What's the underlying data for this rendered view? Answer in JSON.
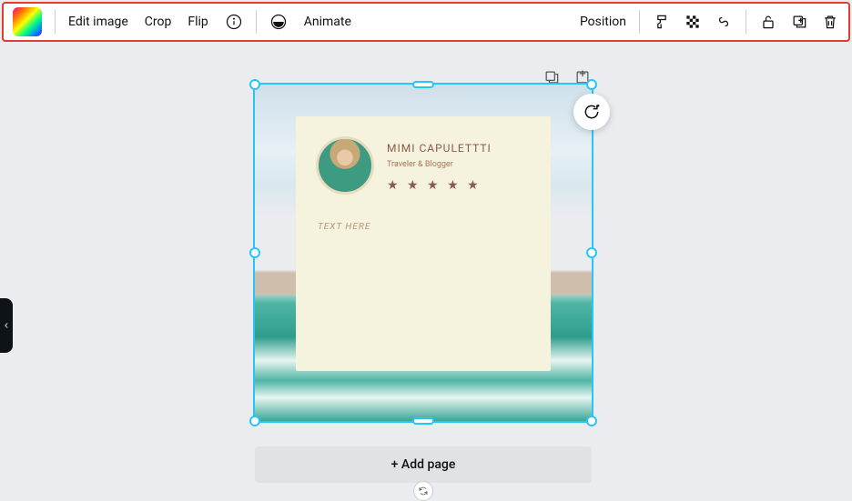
{
  "toolbar": {
    "edit_image": "Edit image",
    "crop": "Crop",
    "flip": "Flip",
    "animate": "Animate",
    "position": "Position"
  },
  "card": {
    "name": "MIMI CAPULETTTI",
    "subtitle": "Traveler & Blogger",
    "stars": "★ ★ ★ ★ ★",
    "placeholder": "TEXT HERE"
  },
  "footer": {
    "add_page": "+ Add page"
  }
}
